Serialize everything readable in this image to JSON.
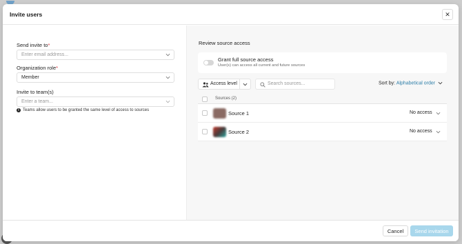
{
  "modal": {
    "title": "Invite users"
  },
  "left": {
    "invite_label": "Send invite to",
    "invite_required": "*",
    "invite_placeholder": "Enter email address...",
    "role_label": "Organization role",
    "role_required": "*",
    "role_value": "Member",
    "team_label": "Invite to team(s)",
    "team_placeholder": "Enter a team...",
    "hint": "Teams allow users to be granted the same level of access to sources"
  },
  "right": {
    "title": "Review source access",
    "grant_title": "Grant full source access",
    "grant_sub": "User(s) can access all current and future sources",
    "grant_toggle_on": false,
    "access_level_label": "Access level",
    "search_placeholder": "Search sources...",
    "sort_label": "Sort by:",
    "sort_value": "Alphabetical order",
    "table_header": "Sources (2)",
    "rows": [
      {
        "name": "Source 1",
        "access": "No access",
        "logo_color": "#8a6a63"
      },
      {
        "name": "Source 2",
        "access": "No access",
        "logo_color": "#8c5a4a"
      }
    ]
  },
  "footer": {
    "cancel_label": "Cancel",
    "send_label": "Send invitation"
  },
  "colors": {
    "accent": "#2d7ea8",
    "send_disabled": "#a8d7ec",
    "required": "#d9363e"
  },
  "icons": [
    "close-icon",
    "chevron-down-icon",
    "info-icon",
    "people-icon",
    "search-icon"
  ]
}
